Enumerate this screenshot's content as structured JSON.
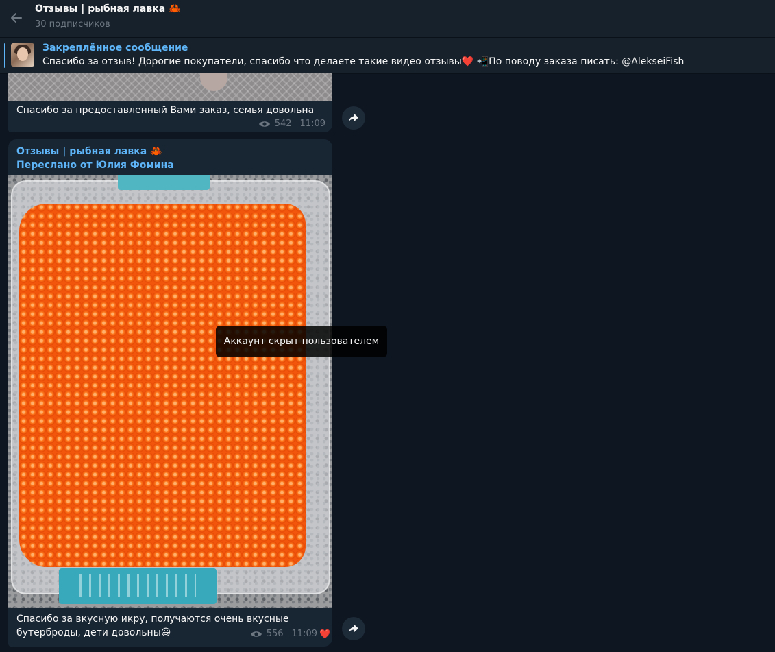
{
  "header": {
    "title": "Отзывы | рыбная лавка 🦀",
    "subtitle": "30 подписчиков"
  },
  "pinned": {
    "title": "Закреплённое сообщение",
    "text_before": "Спасибо за отзыв!  Дорогие покупатели, спасибо что делаете такие видео отзывы",
    "heart": "❤️",
    "text_after": "  📲По поводу заказа писать: @AlekseiFish"
  },
  "messages": [
    {
      "caption": "Спасибо за предоставленный Вами заказ, семья довольна",
      "views": "542",
      "time": "11:09"
    },
    {
      "author": "Отзывы | рыбная лавка 🦀",
      "forwarded": "Переслано от Юлия Фомина",
      "caption": "Спасибо за вкусную икру, получаются очень вкусные бутерброды, дети довольны😃",
      "views": "556",
      "time": "11:09",
      "reaction": "❤️"
    }
  ],
  "tooltip": "Аккаунт скрыт пользователем",
  "icons": {
    "back": "arrow-left-icon",
    "views": "eye-icon",
    "share": "share-arrow-icon"
  }
}
